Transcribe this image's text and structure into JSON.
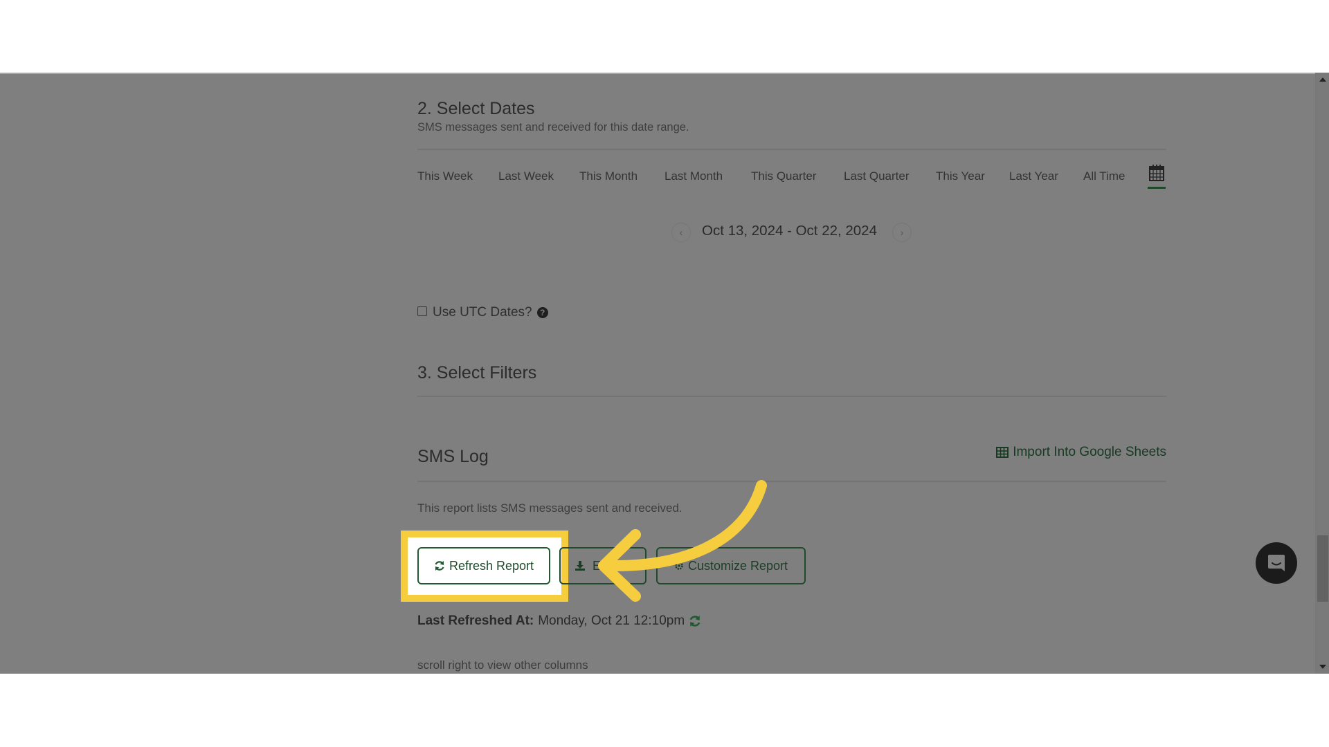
{
  "select_dates": {
    "title": "2. Select Dates",
    "subtitle": "SMS messages sent and received for this date range.",
    "range_tabs": [
      "This Week",
      "Last Week",
      "This Month",
      "Last Month",
      "This Quarter",
      "Last Quarter",
      "This Year",
      "Last Year",
      "All Time"
    ],
    "active_tab": "calendar",
    "date_range": "Oct 13, 2024 - Oct 22, 2024",
    "prev_icon": "chevron-left-icon",
    "next_icon": "chevron-right-icon",
    "utc_label": "Use UTC Dates?",
    "utc_checked": false,
    "help_glyph": "?"
  },
  "select_filters": {
    "title": "3. Select Filters"
  },
  "sms_log": {
    "title": "SMS Log",
    "import_link": "Import Into Google Sheets",
    "description": "This report lists SMS messages sent and received.",
    "buttons": {
      "refresh": "Refresh Report",
      "export": "Export",
      "customize": "Customize Report"
    },
    "last_refreshed_label": "Last Refreshed At:",
    "last_refreshed_value": "Monday, Oct 21 12:10pm",
    "scroll_hint": "scroll right to view other columns"
  },
  "colors": {
    "overlay": "#7f7f7f",
    "accent_green": "#1f4a2c",
    "highlight_yellow": "#f6cd3f"
  }
}
